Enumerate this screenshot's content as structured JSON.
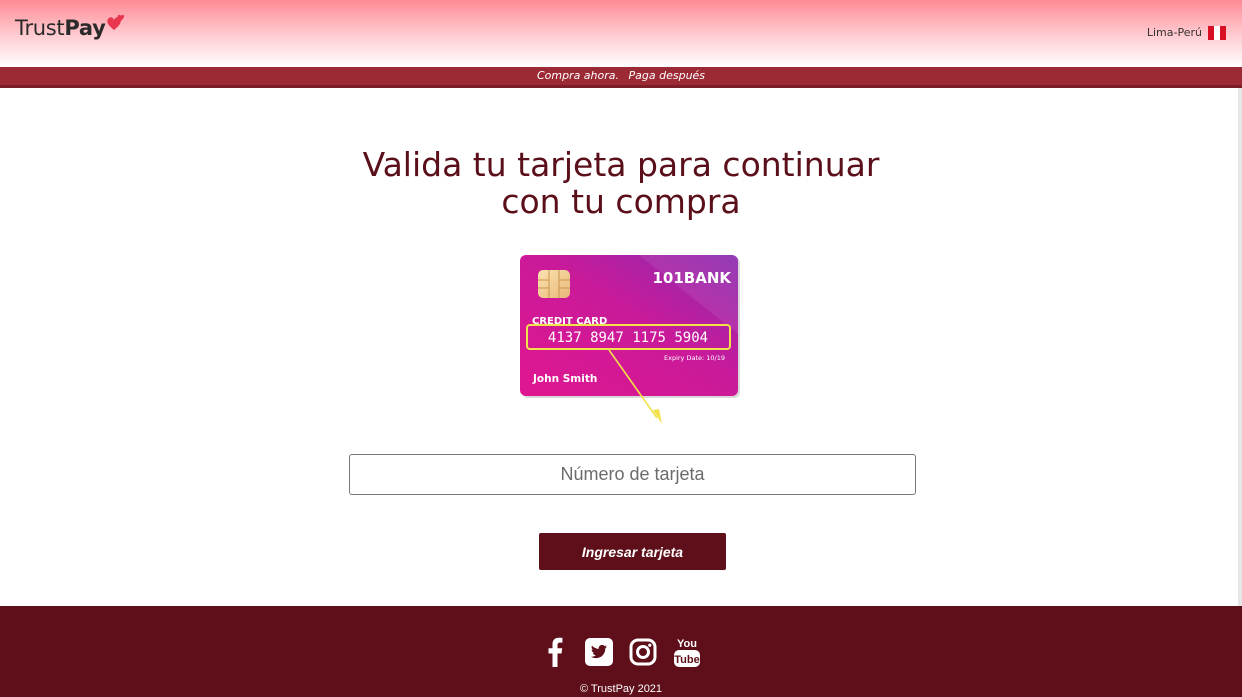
{
  "header": {
    "logo_light": "Trust",
    "logo_bold": "Pay",
    "location": "Lima-Perú",
    "flag_icon": "peru-flag-icon"
  },
  "slogan": {
    "part1": "Compra ahora.",
    "part2": "Paga después"
  },
  "main": {
    "title_line1": "Valida tu tarjeta para continuar",
    "title_line2": "con tu compra",
    "card": {
      "bank": "101BANK",
      "type": "CREDIT CARD",
      "number": "4137 8947 1175 5904",
      "expiry": "Expiry Date: 10/19",
      "holder": "John Smith"
    },
    "input_placeholder": "Número de tarjeta",
    "input_value": "",
    "submit_label": "Ingresar tarjeta"
  },
  "footer": {
    "social_icons": [
      "facebook-icon",
      "twitter-icon",
      "instagram-icon",
      "youtube-icon"
    ],
    "youtube_text_top": "You",
    "youtube_text_bottom": "Tube",
    "copyright": "© TrustPay 2021"
  },
  "colors": {
    "brand_dark": "#5e0f1a",
    "brand_bar": "#9c2a35",
    "header_pink": "#ff8a95",
    "card_magenta": "#e0168f",
    "card_purple": "#8a2cb0",
    "highlight_yellow": "#f2e24a"
  }
}
